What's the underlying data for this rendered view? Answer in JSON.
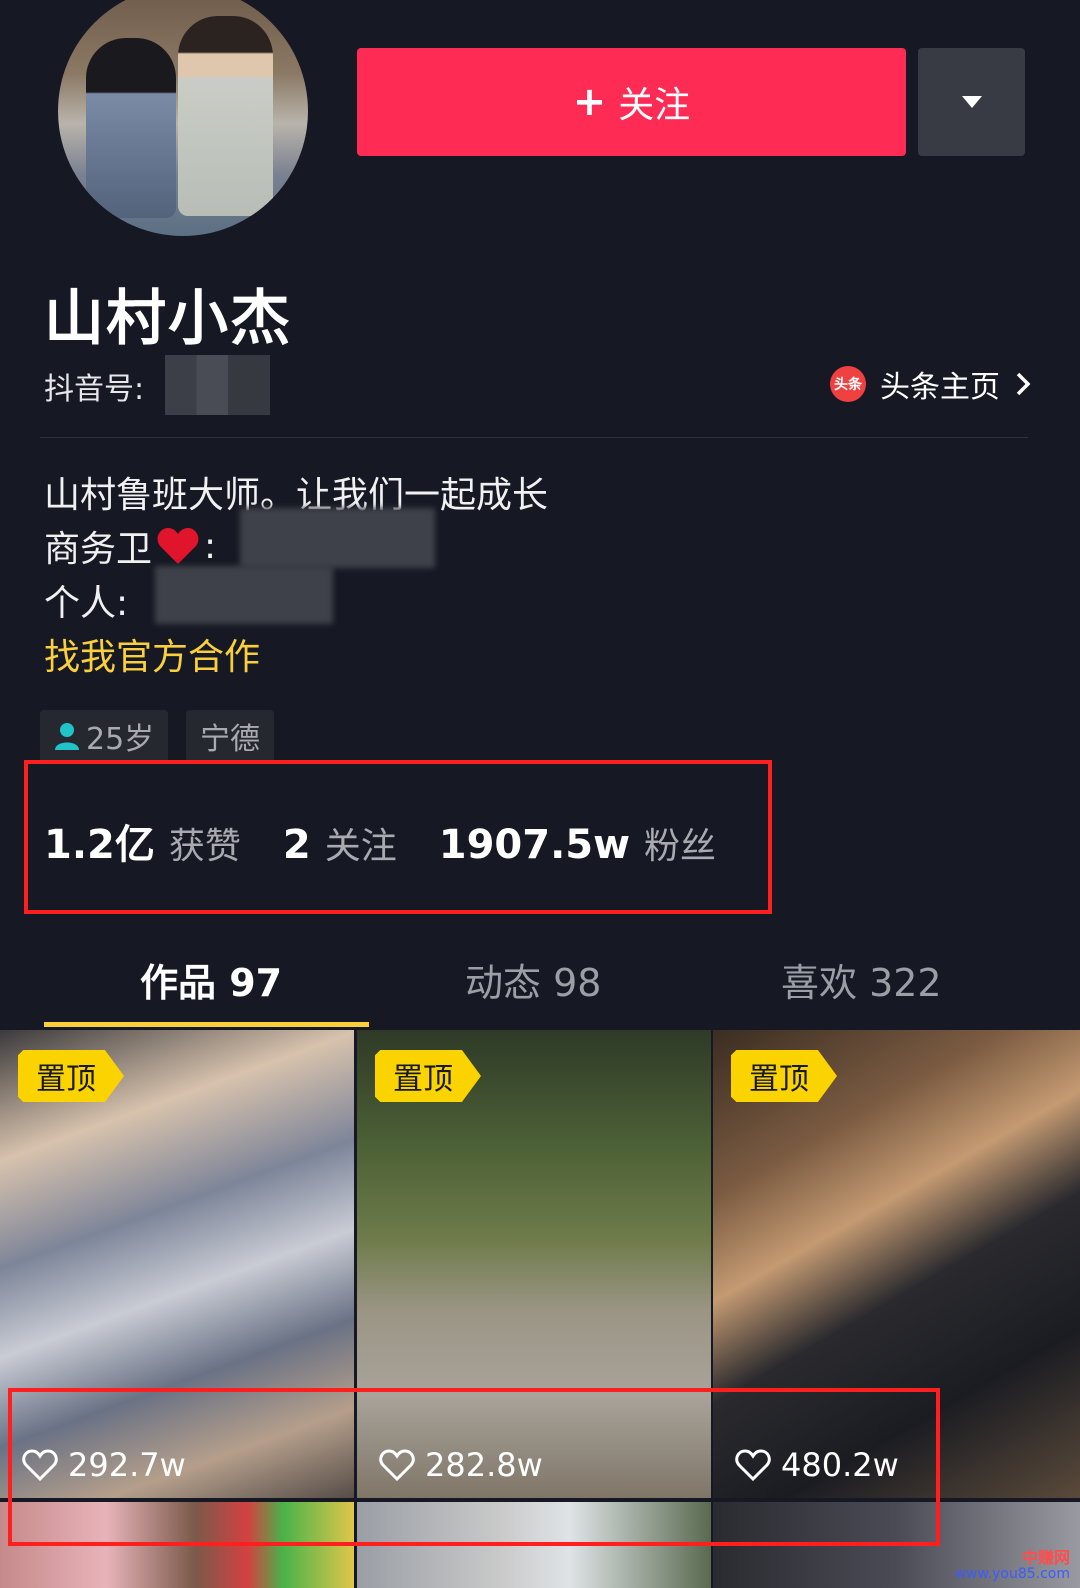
{
  "profile": {
    "nickname": "山村小杰",
    "uid_label": "抖音号:",
    "toutiao_icon_text": "头条",
    "toutiao_link": "头条主页"
  },
  "actions": {
    "follow_label": "关注",
    "follow_plus": "+"
  },
  "bio": {
    "line1": "山村鲁班大师。让我们一起成长",
    "line2_label": "商务卫",
    "line2_colon": ":",
    "line3_label": "个人:",
    "link": "找我官方合作"
  },
  "tags": {
    "age": "25岁",
    "location": "宁德"
  },
  "stats": {
    "likes_num": "1.2亿",
    "likes_label": "获赞",
    "following_num": "2",
    "following_label": "关注",
    "fans_num": "1907.5w",
    "fans_label": "粉丝"
  },
  "tabs": [
    {
      "label": "作品 97",
      "active": true
    },
    {
      "label": "动态 98",
      "active": false
    },
    {
      "label": "喜欢 322",
      "active": false
    }
  ],
  "videos": [
    {
      "pin": "置顶",
      "likes": "292.7w"
    },
    {
      "pin": "置顶",
      "likes": "282.8w"
    },
    {
      "pin": "置顶",
      "likes": "480.2w"
    }
  ],
  "colors": {
    "background": "#161823",
    "accent": "#fe2c55",
    "highlight": "#facf3e",
    "annotation": "#ff1f1f"
  },
  "watermark": {
    "line1": "中赚网",
    "line2": "www.you85.com"
  }
}
